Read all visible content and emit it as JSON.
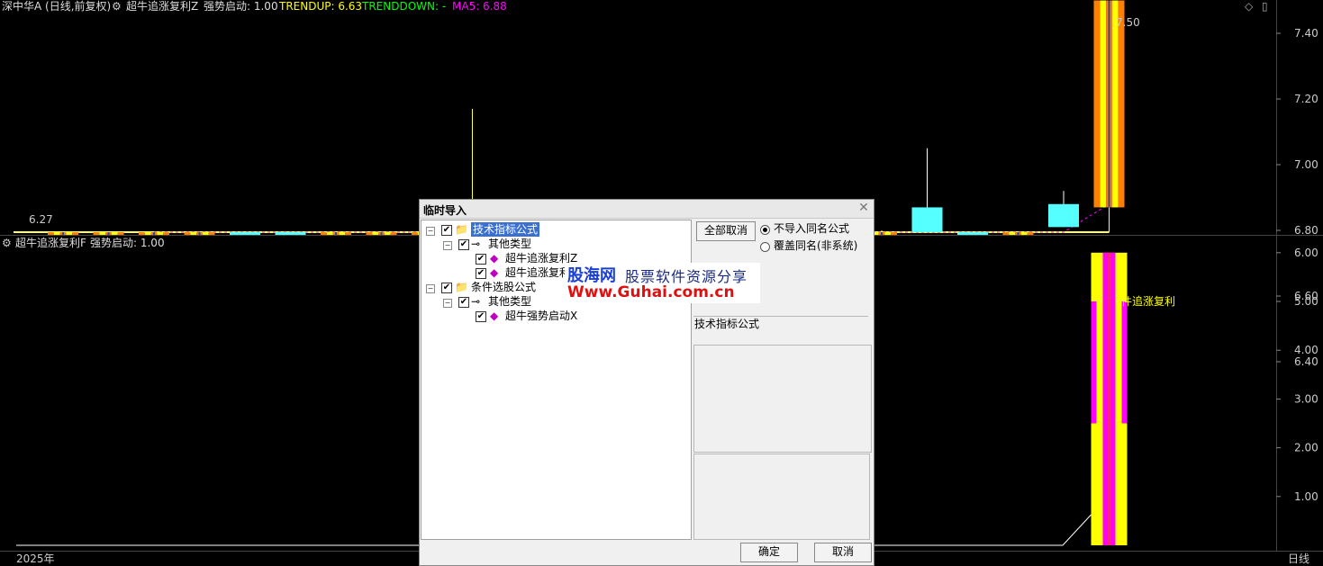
{
  "header": {
    "symbol": "深中华A (日线,前复权)",
    "indicator": "超牛追涨复利Z",
    "strong_label": "强势启动: 1.00",
    "trendup": "TRENDUP: 6.63",
    "trenddown": "TRENDDOWN: -",
    "ma5": "MA5: 6.88"
  },
  "sub_header": {
    "indicator": "超牛追涨复利F",
    "strong_label": "强势启动: 1.00"
  },
  "price_axis": [
    "7.40",
    "7.20",
    "7.00",
    "6.80",
    "6.60",
    "6.40"
  ],
  "sub_axis": [
    "6.00",
    "5.00",
    "4.00",
    "3.00",
    "2.00",
    "1.00"
  ],
  "annotations": {
    "high_label": "7.50",
    "low_label": "6.27",
    "sub_label": "件追涨复利"
  },
  "footer": {
    "year": "2025年",
    "period": "日线"
  },
  "colors": {
    "up_cyan": "#55ffff",
    "orange": "#ff8000",
    "yellow": "#ffff00",
    "magenta": "#ff00ff",
    "ma_line": "#ffff55",
    "green": "#00c000"
  },
  "chart_data": {
    "type": "candlestick",
    "ylim": [
      6.27,
      7.5
    ],
    "candles": [
      {
        "open": 6.35,
        "high": 6.37,
        "low": 6.32,
        "close": 6.33,
        "style": "orange"
      },
      {
        "open": 6.36,
        "high": 6.37,
        "low": 6.35,
        "close": 6.36,
        "style": "orange"
      },
      {
        "open": 6.37,
        "high": 6.45,
        "low": 6.36,
        "close": 6.44,
        "style": "orange"
      },
      {
        "open": 6.52,
        "high": 6.73,
        "low": 6.51,
        "close": 6.65,
        "style": "orange"
      },
      {
        "open": 6.64,
        "high": 6.67,
        "low": 6.52,
        "close": 6.52,
        "style": "cyan"
      },
      {
        "open": 6.5,
        "high": 6.6,
        "low": 6.39,
        "close": 6.39,
        "style": "cyan"
      },
      {
        "open": 6.4,
        "high": 6.43,
        "low": 6.38,
        "close": 6.42,
        "style": "orange"
      },
      {
        "open": 6.42,
        "high": 6.51,
        "low": 6.41,
        "close": 6.51,
        "style": "orange"
      },
      {
        "open": 6.55,
        "high": 6.59,
        "low": 6.53,
        "close": 6.58,
        "style": "orange"
      },
      {
        "open": 6.58,
        "high": 7.17,
        "low": 6.53,
        "close": 6.84,
        "style": "orange"
      },
      {
        "open": 6.85,
        "high": 6.88,
        "low": 6.75,
        "close": 6.76,
        "style": "cyan"
      },
      {
        "open": 6.72,
        "high": 6.8,
        "low": 6.67,
        "close": 6.8,
        "style": "orange"
      },
      {
        "open": 6.87,
        "high": 6.87,
        "low": 6.74,
        "close": 6.74,
        "style": "cyan"
      },
      {
        "open": 6.7,
        "high": 6.76,
        "low": 6.69,
        "close": 6.76,
        "style": "orange"
      },
      {
        "open": 6.74,
        "high": 6.74,
        "low": 6.53,
        "close": 6.53,
        "style": "cyan"
      },
      {
        "open": 6.52,
        "high": 6.61,
        "low": 6.4,
        "close": 6.5,
        "style": "cyan"
      },
      {
        "open": 6.47,
        "high": 6.51,
        "low": 6.45,
        "close": 6.5,
        "style": "orange"
      },
      {
        "open": 6.53,
        "high": 6.7,
        "low": 6.52,
        "close": 6.68,
        "style": "orange"
      },
      {
        "open": 6.67,
        "high": 6.8,
        "low": 6.63,
        "close": 6.76,
        "style": "orange"
      },
      {
        "open": 6.87,
        "high": 7.05,
        "low": 6.63,
        "close": 6.63,
        "style": "cyan"
      },
      {
        "open": 6.75,
        "high": 6.77,
        "low": 6.6,
        "close": 6.68,
        "style": "cyan"
      },
      {
        "open": 6.68,
        "high": 6.79,
        "low": 6.54,
        "close": 6.78,
        "style": "orange"
      },
      {
        "open": 6.88,
        "high": 6.92,
        "low": 6.81,
        "close": 6.81,
        "style": "cyan"
      },
      {
        "open": 6.87,
        "high": 7.5,
        "low": 6.77,
        "close": 7.5,
        "style": "orange"
      }
    ],
    "ma_line": [
      6.36,
      6.36,
      6.37,
      6.38,
      6.39,
      6.4,
      6.4,
      6.41,
      6.42,
      6.44,
      6.46,
      6.48,
      6.5,
      6.51,
      6.53,
      6.53,
      6.54,
      6.56,
      6.57,
      6.58,
      6.59,
      6.6,
      6.6,
      6.63
    ],
    "ma5": [
      null,
      null,
      6.4,
      6.47,
      6.49,
      6.48,
      6.48,
      6.49,
      6.49,
      6.57,
      6.61,
      6.68,
      6.73,
      6.74,
      6.72,
      6.66,
      6.59,
      6.57,
      6.6,
      6.62,
      6.64,
      6.67,
      6.69,
      6.88
    ],
    "sub_indicator": {
      "value": 6.0,
      "ylim": [
        0,
        6.4
      ]
    }
  },
  "dialog": {
    "title": "临时导入",
    "tree": [
      {
        "label": "技术指标公式",
        "level": 0,
        "folder": true,
        "selected": true
      },
      {
        "label": "其他类型",
        "level": 1,
        "key": true
      },
      {
        "label": "超牛追涨复利Z",
        "level": 2
      },
      {
        "label": "超牛追涨复利F",
        "level": 2
      },
      {
        "label": "条件选股公式",
        "level": 0,
        "folder": true
      },
      {
        "label": "其他类型",
        "level": 1,
        "key": true
      },
      {
        "label": "超牛强势启动X",
        "level": 2
      }
    ],
    "deselect_all": "全部取消",
    "radio_options": [
      "不导入同名公式",
      "覆盖同名(非系统)"
    ],
    "info_label": "技术指标公式",
    "ok": "确定",
    "cancel": "取消"
  },
  "watermark": {
    "line1_a": "股海网",
    "line1_b": "股票软件资源分享",
    "line2": "Www.Guhai.com.cn"
  }
}
